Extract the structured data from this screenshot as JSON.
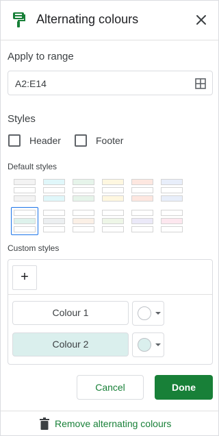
{
  "header": {
    "title": "Alternating colours",
    "icon": "paint-format-icon",
    "close_icon": "close-icon"
  },
  "range": {
    "label": "Apply to range",
    "value": "A2:E14",
    "icon": "grid-select-icon"
  },
  "styles": {
    "label": "Styles",
    "header_checkbox": {
      "label": "Header",
      "checked": false
    },
    "footer_checkbox": {
      "label": "Footer",
      "checked": false
    }
  },
  "default_styles": {
    "label": "Default styles",
    "swatches": [
      {
        "colors": [
          "#f3f3f3",
          "#ffffff",
          "#f3f3f3"
        ],
        "selected": false
      },
      {
        "colors": [
          "#e0f7fa",
          "#ffffff",
          "#e0f7fa"
        ],
        "selected": false
      },
      {
        "colors": [
          "#e6f4ea",
          "#ffffff",
          "#e6f4ea"
        ],
        "selected": false
      },
      {
        "colors": [
          "#fef7e0",
          "#ffffff",
          "#fef7e0"
        ],
        "selected": false
      },
      {
        "colors": [
          "#fde7e0",
          "#ffffff",
          "#fde7e0"
        ],
        "selected": false
      },
      {
        "colors": [
          "#e8eefa",
          "#ffffff",
          "#e8eefa"
        ],
        "selected": false
      },
      {
        "colors": [
          "#ffffff",
          "#def2ec",
          "#ffffff"
        ],
        "selected": true
      },
      {
        "colors": [
          "#ffffff",
          "#eceff1",
          "#ffffff"
        ],
        "selected": false
      },
      {
        "colors": [
          "#ffffff",
          "#fbf0e6",
          "#ffffff"
        ],
        "selected": false
      },
      {
        "colors": [
          "#ffffff",
          "#eef6e7",
          "#ffffff"
        ],
        "selected": false
      },
      {
        "colors": [
          "#ffffff",
          "#ebe9f8",
          "#ffffff"
        ],
        "selected": false
      },
      {
        "colors": [
          "#ffffff",
          "#fde7ef",
          "#ffffff"
        ],
        "selected": false
      }
    ]
  },
  "custom_styles": {
    "label": "Custom styles",
    "add_label": "+",
    "colour1": {
      "label": "Colour 1",
      "fill": "#ffffff",
      "swatch": "#ffffff"
    },
    "colour2": {
      "label": "Colour 2",
      "fill": "#daefed",
      "swatch": "#daefed"
    }
  },
  "actions": {
    "cancel": "Cancel",
    "done": "Done"
  },
  "remove": {
    "label": "Remove alternating colours",
    "icon": "trash-icon"
  },
  "colors": {
    "accent": "#188038",
    "selection": "#1a73e8"
  }
}
